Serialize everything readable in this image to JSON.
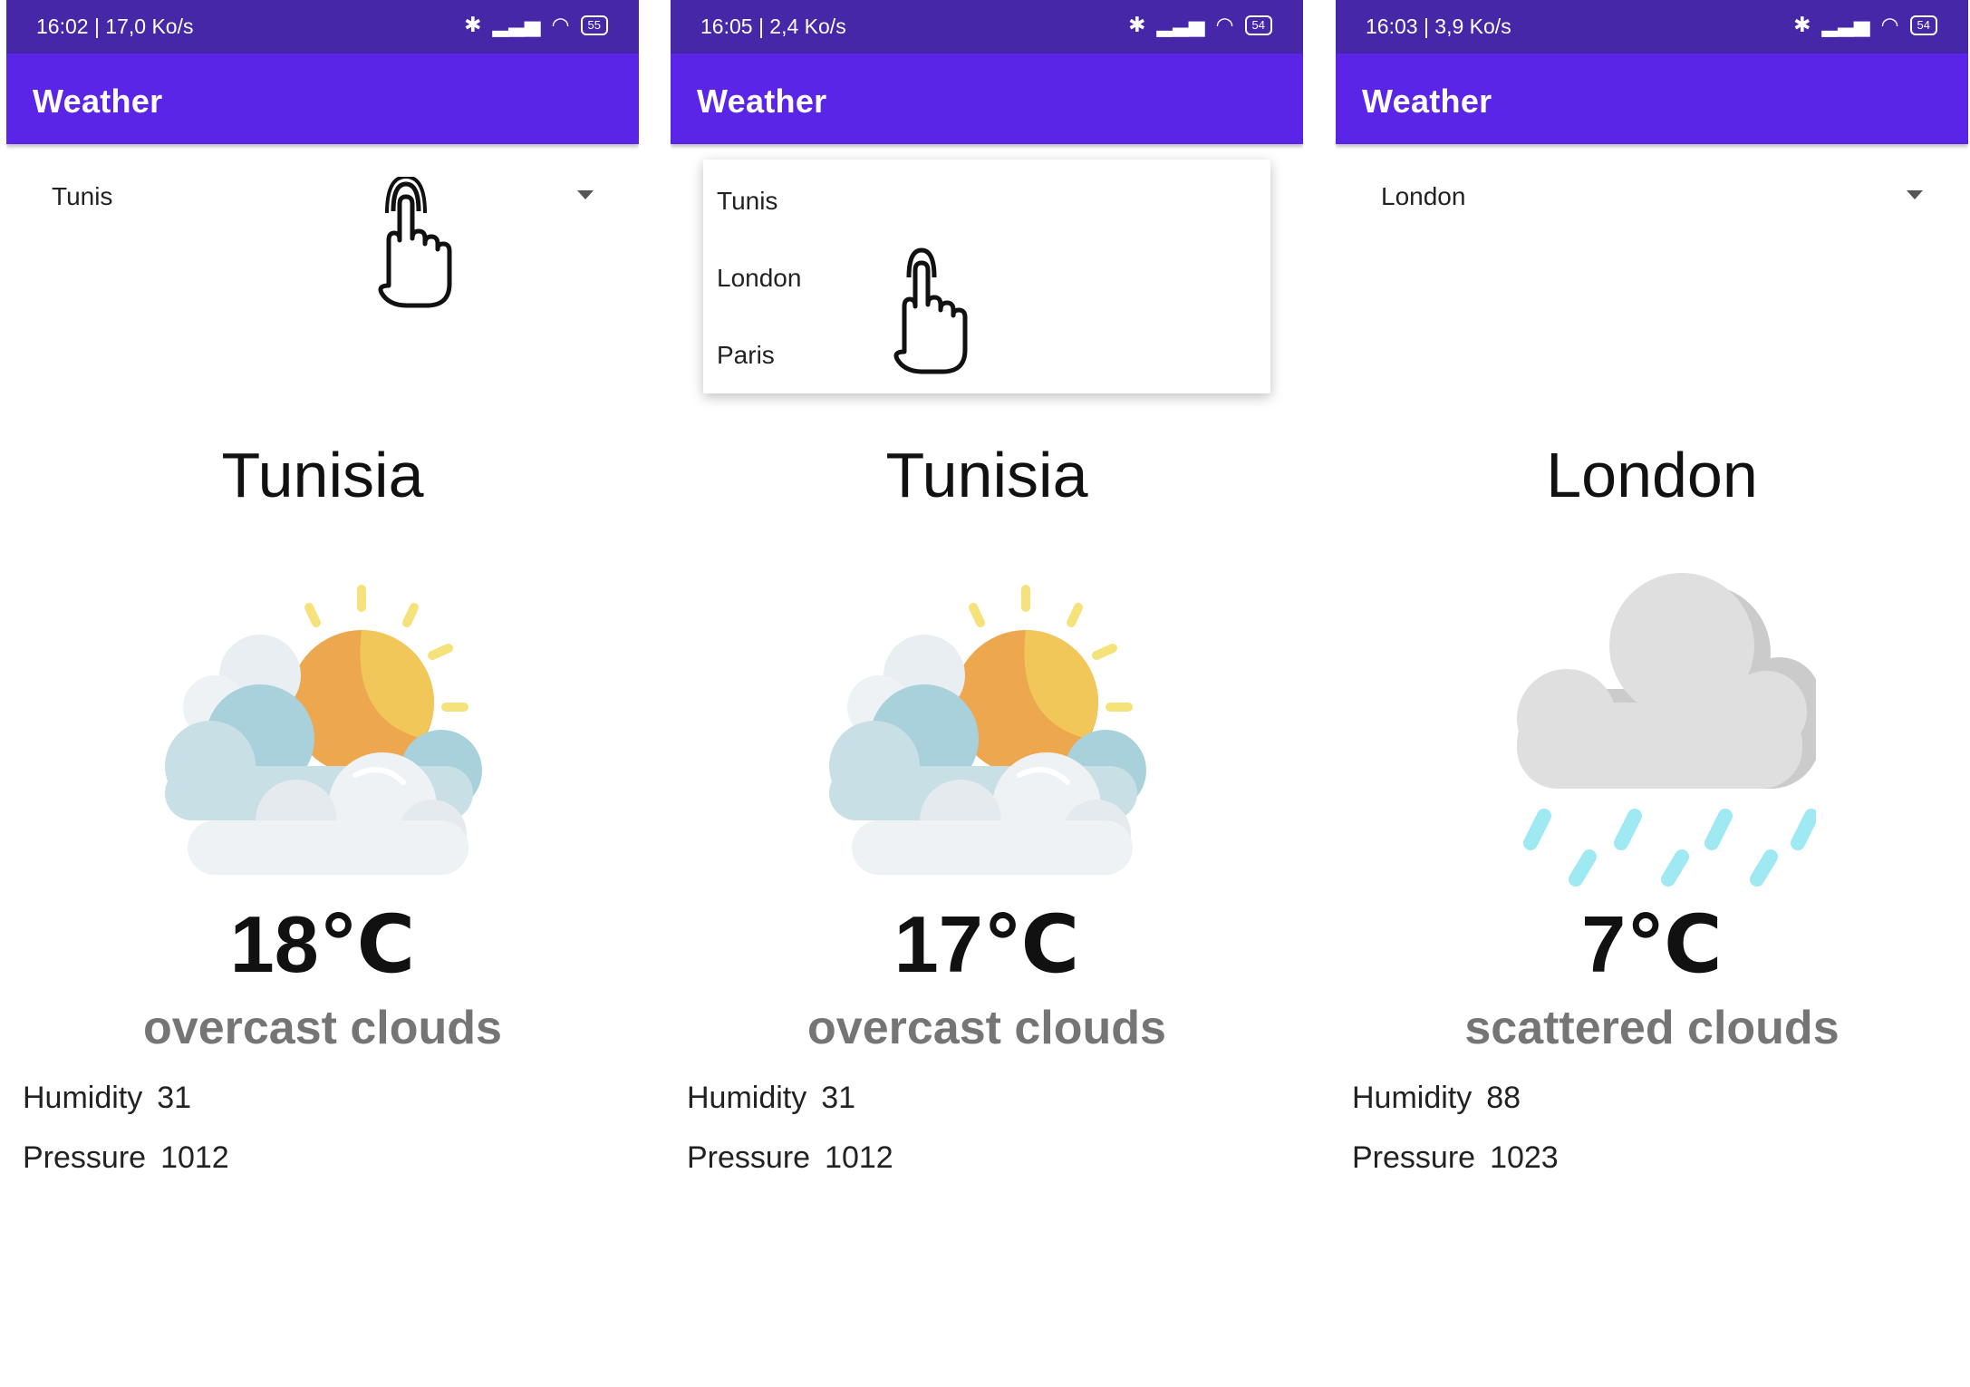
{
  "screens": [
    {
      "status": {
        "time_speed": "16:02 | 17,0 Ko/s",
        "battery": "55"
      },
      "app_title": "Weather",
      "spinner_value": "Tunis",
      "city": "Tunisia",
      "weather_icon": "sun-behind-clouds-icon",
      "temperature": "18℃",
      "description": "overcast clouds",
      "humidity_label": "Humidity",
      "humidity_value": "31",
      "pressure_label": "Pressure",
      "pressure_value": "1012"
    },
    {
      "status": {
        "time_speed": "16:05 | 2,4 Ko/s",
        "battery": "54"
      },
      "app_title": "Weather",
      "dropdown_options": [
        "Tunis",
        "London",
        "Paris"
      ],
      "city": "Tunisia",
      "weather_icon": "sun-behind-clouds-icon",
      "temperature": "17℃",
      "description": "overcast clouds",
      "humidity_label": "Humidity",
      "humidity_value": "31",
      "pressure_label": "Pressure",
      "pressure_value": "1012"
    },
    {
      "status": {
        "time_speed": "16:03 | 3,9 Ko/s",
        "battery": "54"
      },
      "app_title": "Weather",
      "spinner_value": "London",
      "city": "London",
      "weather_icon": "rain-cloud-icon",
      "temperature": "7℃",
      "description": "scattered clouds",
      "humidity_label": "Humidity",
      "humidity_value": "88",
      "pressure_label": "Pressure",
      "pressure_value": "1023"
    }
  ],
  "colors": {
    "status_bar": "#4527a8",
    "app_bar": "#5a25e6",
    "description_text": "#757575"
  }
}
